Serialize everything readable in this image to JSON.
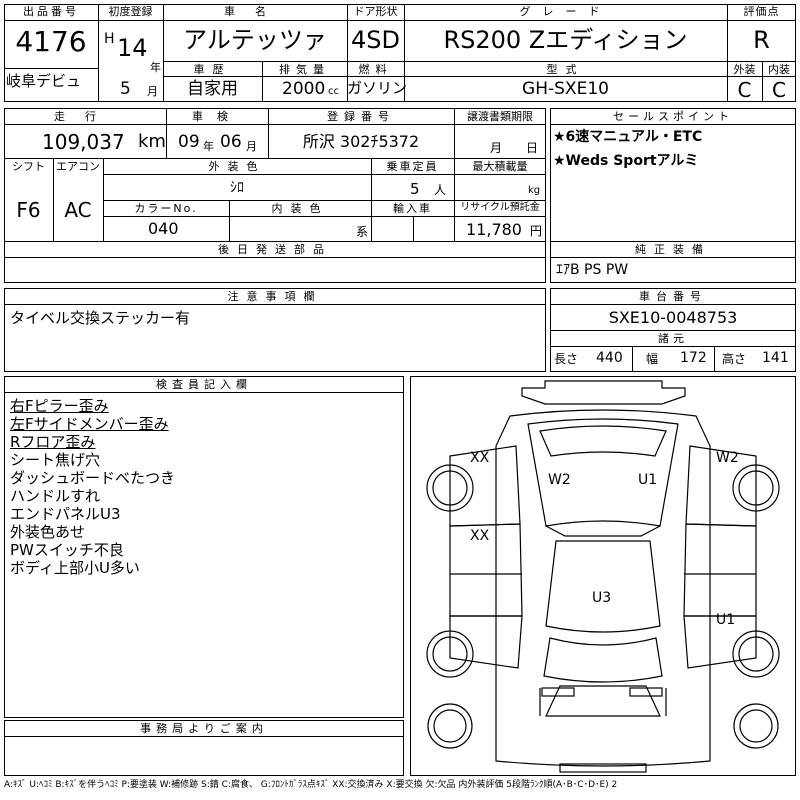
{
  "header": {
    "lot_no_label": "出品番号",
    "lot_no": "4176",
    "auction": "岐阜デビュ",
    "first_reg_label": "初度登録",
    "era": "H",
    "first_reg_year": "14",
    "year_unit": "年",
    "first_reg_month": "5",
    "month_unit": "月",
    "car_name_label": "車名",
    "car_name": "アルテッツァ",
    "history_label": "車歴",
    "history": "自家用",
    "displacement_label": "排気量",
    "displacement": "2000",
    "displacement_unit": "cc",
    "door_label": "ドア形状",
    "door": "4SD",
    "fuel_label": "燃料",
    "fuel": "ガソリン",
    "grade_label": "グレード",
    "grade": "RS200 Zエディション",
    "model_code_label": "型式",
    "model_code": "GH-SXE10",
    "score_label": "評価点",
    "score": "R",
    "ext_label": "外装",
    "ext_score": "C",
    "int_label": "内装",
    "int_score": "C"
  },
  "row2": {
    "mileage_label": "走行",
    "mileage": "109,037",
    "mileage_unit": "km",
    "inspection_label": "車検",
    "inspection_year": "09",
    "inspection_year_unit": "年",
    "inspection_month": "06",
    "inspection_month_unit": "月",
    "plate_label": "登録番号",
    "plate": "所沢 302ﾁ5372",
    "transfer_label": "譲渡書類期限",
    "transfer_month_unit": "月",
    "transfer_day_unit": "日",
    "shift_label": "シフト",
    "shift": "F6",
    "ac_label": "エアコン",
    "ac": "AC",
    "color_label": "外装色",
    "color": "ｼﾛ",
    "capacity_label": "乗車定員",
    "capacity": "5",
    "capacity_unit": "人",
    "load_label": "最大積載量",
    "load_unit": "kg",
    "color_no_label": "カラーNo.",
    "color_no": "040",
    "interior_color_label": "内装色",
    "interior_color_unit": "系",
    "import_label": "輸入車",
    "recycle_label": "リサイクル預託金",
    "recycle": "11,780",
    "recycle_unit": "円"
  },
  "sales_points": {
    "label": "セールスポイント",
    "items": [
      "★6速マニュアル・ETC",
      "★Weds Sportアルミ"
    ]
  },
  "later_parts": {
    "label": "後日発送部品"
  },
  "equipment": {
    "label": "純正装備",
    "value": "ｴｱB PS PW"
  },
  "notes": {
    "label": "注意事項欄",
    "value": "タイベル交換ステッカー有"
  },
  "chassis": {
    "label": "車台番号",
    "value": "SXE10-0048753",
    "spec_label": "諸元",
    "length_label": "長さ",
    "length": "440",
    "width_label": "幅",
    "width": "172",
    "height_label": "高さ",
    "height": "141"
  },
  "inspector": {
    "label": "検査員記入欄",
    "lines": [
      {
        "text": "右Fピラー歪み",
        "underline": true
      },
      {
        "text": "左Fサイドメンバー歪み",
        "underline": true
      },
      {
        "text": "Rフロア歪み",
        "underline": true
      },
      {
        "text": "シート焦げ穴",
        "underline": false
      },
      {
        "text": "ダッシュボードべたつき",
        "underline": false
      },
      {
        "text": "ハンドルすれ",
        "underline": false
      },
      {
        "text": "エンドパネルU3",
        "underline": false
      },
      {
        "text": "外装色あせ",
        "underline": false
      },
      {
        "text": "PWスイッチ不良",
        "underline": false
      },
      {
        "text": "ボディ上部小U多い",
        "underline": false
      }
    ]
  },
  "office": {
    "label": "事務局よりご案内"
  },
  "diagram": {
    "marks": {
      "front_left": "XX",
      "roof_left": "W2",
      "roof_right": "U1",
      "front_right": "W2",
      "left_door": "XX",
      "trunk": "U3",
      "rear_right": "U1"
    }
  },
  "legend": "A:ｷｽﾞ U:ﾍｺﾐ B:ｷｽﾞを伴うﾍｺﾐ P:要塗装 W:補修跡 S:錆 C:腐食、 G:ﾌﾛﾝﾄｶﾞﾗｽ点ｷｽﾞ XX:交換済み X:要交換 欠:欠品 内外装評価 5段階ﾗﾝｸ順(A･B･C･D･E) 2"
}
